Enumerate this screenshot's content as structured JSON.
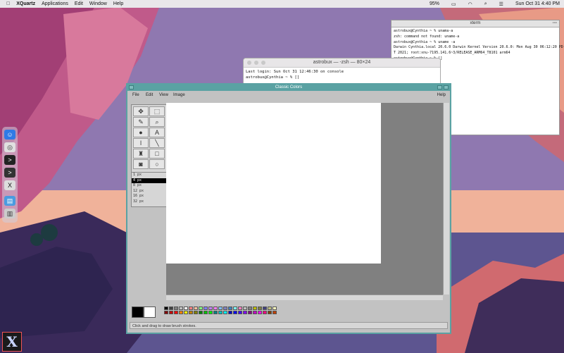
{
  "menubar": {
    "app_name": "XQuartz",
    "items": [
      "Applications",
      "Edit",
      "Window",
      "Help"
    ],
    "battery": "95%",
    "datetime": "Sun Oct 31  4:40 PM"
  },
  "xterm": {
    "title": "xterm",
    "lines": [
      "astrobux@Cynthia ~ % unama-a",
      "zsh: command not found: uname-a",
      "astrobux@Cynthia ~ % uname -a",
      "Darwin Cynthia.local 20.6.0 Darwin Kernel Version 20.6.0: Mon Aug 30 06:12:20 PD",
      "T 2021; root:xnu-7195.141.6~3/RELEASE_ARM64_T8101 arm64",
      "astrobux@Cynthia ~ % []"
    ]
  },
  "zsh": {
    "title": "astrobux — -zsh — 80×24",
    "lines": [
      "Last login: Sun Oct 31 12:46:30 on console",
      "astrobux@Cynthia ~ % []"
    ]
  },
  "paint": {
    "title": "Classic Colors",
    "menu": {
      "file": "File",
      "edit": "Edit",
      "view": "View",
      "image": "Image",
      "help": "Help"
    },
    "sizes": [
      "1 px",
      "4 px",
      "8 px",
      "12 px",
      "16 px",
      "32 px"
    ],
    "selected_size": "4 px",
    "status": "Click and drag to draw brush strokes.",
    "palette": [
      "#000000",
      "#404040",
      "#808080",
      "#c0c0c0",
      "#ffffff",
      "#ff8080",
      "#ffc0a0",
      "#80ff80",
      "#8080ff",
      "#c080ff",
      "#ff80ff",
      "#80c0ff",
      "#8080c0",
      "#4080c0",
      "#80ffff",
      "#ff80c0",
      "#c0c0c0",
      "#808080",
      "#c0c000",
      "#808040",
      "#404080",
      "#c0c080",
      "#ffffc0",
      "#800000",
      "#c00000",
      "#ff0000",
      "#ff8000",
      "#ffff00",
      "#c08000",
      "#808000",
      "#008000",
      "#00c000",
      "#00ff00",
      "#008080",
      "#00c0c0",
      "#00ffff",
      "#0000c0",
      "#0000ff",
      "#4000ff",
      "#8000ff",
      "#800080",
      "#c000c0",
      "#ff00ff",
      "#ff0080",
      "#804000",
      "#c04000"
    ]
  }
}
